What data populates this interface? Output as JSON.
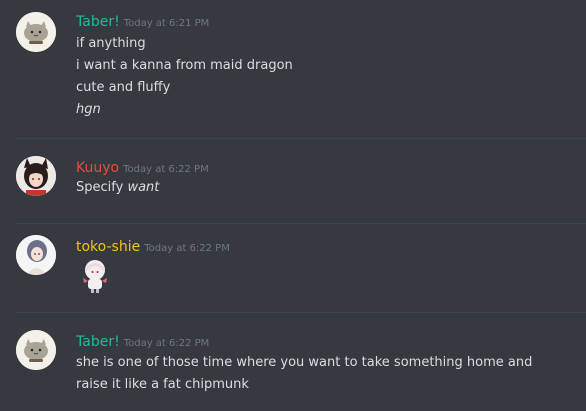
{
  "colors": {
    "background": "#36393f",
    "divider": "#40444b",
    "timestamp": "#72767d",
    "text": "#dcddde",
    "taber": "#1abc9c",
    "kuuyo": "#e74c3c",
    "toko": "#f1c40f"
  },
  "messages": [
    {
      "author": "Taber!",
      "timestamp": "Today at 6:21 PM",
      "avatar_icon": "pusheen-cat-avatar-icon",
      "lines": [
        "if anything",
        "i want a kanna from maid dragon",
        "cute and fluffy",
        "hgn"
      ]
    },
    {
      "author": "Kuuyo",
      "timestamp": "Today at 6:22 PM",
      "avatar_icon": "anime-girl-avatar-icon",
      "text_prefix": "Specify ",
      "text_italic": "want"
    },
    {
      "author": "toko-shie",
      "timestamp": "Today at 6:22 PM",
      "avatar_icon": "anime-girl-white-avatar-icon",
      "sticker_icon": "kanna-emoji-icon"
    },
    {
      "author": "Taber!",
      "timestamp": "Today at 6:22 PM",
      "avatar_icon": "pusheen-cat-avatar-icon",
      "text": "she is one of those time where you want to take something home and raise it like a fat chipmunk"
    }
  ]
}
